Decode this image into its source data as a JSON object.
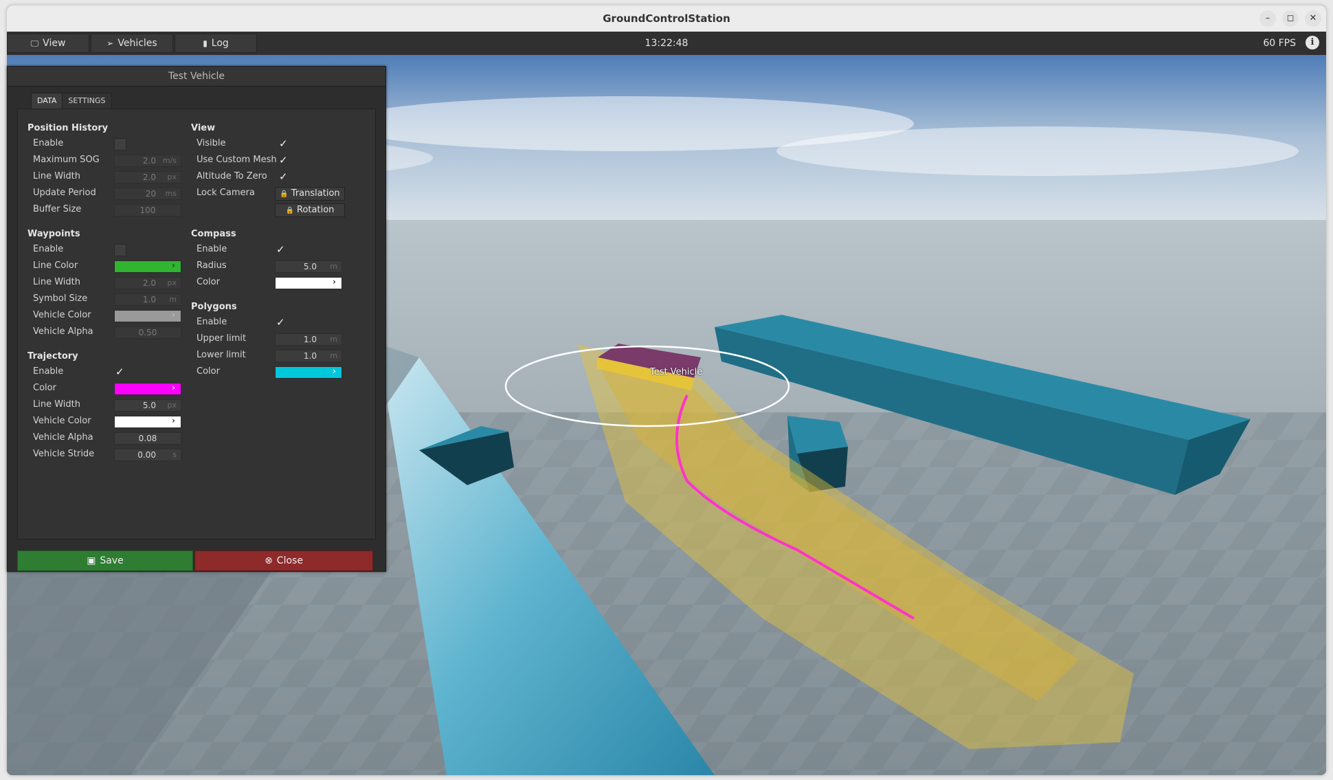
{
  "window": {
    "title": "GroundControlStation",
    "controls": {
      "minimize": "–",
      "maximize": "◻",
      "close": "✕"
    }
  },
  "menubar": {
    "items": [
      {
        "label": "View",
        "icon": "monitor-icon",
        "glyph": "🖵"
      },
      {
        "label": "Vehicles",
        "icon": "paper-plane-icon",
        "glyph": "➢"
      },
      {
        "label": "Log",
        "icon": "clipboard-icon",
        "glyph": "▮"
      }
    ],
    "clock": "13:22:48",
    "fps": "60 FPS",
    "info_glyph": "i"
  },
  "scene": {
    "vehicle_label": "Test Vehicle",
    "colors": {
      "sky_top": "#5e87bd",
      "ground": "#8a969c",
      "obstacle": "#1f6e86",
      "trajectory": "#ff33cc",
      "history": "#e6c43a"
    }
  },
  "panel": {
    "title": "Test Vehicle",
    "tabs": [
      "DATA",
      "SETTINGS"
    ],
    "active_tab": "DATA",
    "position_history": {
      "title": "Position History",
      "enable_label": "Enable",
      "enable": false,
      "max_sog_label": "Maximum SOG",
      "max_sog": "2.0",
      "max_sog_unit": "m/s",
      "line_width_label": "Line Width",
      "line_width": "2.0",
      "line_width_unit": "px",
      "update_period_label": "Update Period",
      "update_period": "20",
      "update_period_unit": "ms",
      "buffer_size_label": "Buffer Size",
      "buffer_size": "100"
    },
    "waypoints": {
      "title": "Waypoints",
      "enable_label": "Enable",
      "enable": false,
      "line_color_label": "Line Color",
      "line_color": "#2fb52f",
      "line_width_label": "Line Width",
      "line_width": "2.0",
      "line_width_unit": "px",
      "symbol_size_label": "Symbol Size",
      "symbol_size": "1.0",
      "symbol_size_unit": "m",
      "vehicle_color_label": "Vehicle Color",
      "vehicle_color": "#9a9a9a",
      "vehicle_alpha_label": "Vehicle Alpha",
      "vehicle_alpha": "0.50"
    },
    "trajectory": {
      "title": "Trajectory",
      "enable_label": "Enable",
      "enable": true,
      "color_label": "Color",
      "color": "#ff00ff",
      "line_width_label": "Line Width",
      "line_width": "5.0",
      "line_width_unit": "px",
      "vehicle_color_label": "Vehicle Color",
      "vehicle_color": "#ffffff",
      "vehicle_alpha_label": "Vehicle Alpha",
      "vehicle_alpha": "0.08",
      "vehicle_stride_label": "Vehicle Stride",
      "vehicle_stride": "0.00",
      "vehicle_stride_unit": "s"
    },
    "view": {
      "title": "View",
      "visible_label": "Visible",
      "visible": true,
      "custom_mesh_label": "Use Custom Mesh",
      "custom_mesh": true,
      "alt_zero_label": "Altitude To Zero",
      "alt_zero": true,
      "lock_camera_label": "Lock Camera",
      "translation_label": "Translation",
      "rotation_label": "Rotation"
    },
    "compass": {
      "title": "Compass",
      "enable_label": "Enable",
      "enable": true,
      "radius_label": "Radius",
      "radius": "5.0",
      "radius_unit": "m",
      "color_label": "Color",
      "color": "#ffffff"
    },
    "polygons": {
      "title": "Polygons",
      "enable_label": "Enable",
      "enable": true,
      "upper_label": "Upper limit",
      "upper": "1.0",
      "upper_unit": "m",
      "lower_label": "Lower limit",
      "lower": "1.0",
      "lower_unit": "m",
      "color_label": "Color",
      "color": "#00c8dc"
    },
    "buttons": {
      "save_label": "Save",
      "save_color": "#2e7d32",
      "close_label": "Close",
      "close_color": "#8e2a2a"
    },
    "check_glyph": "✓",
    "arrow_glyph": "›",
    "lock_glyph": "🔒"
  }
}
